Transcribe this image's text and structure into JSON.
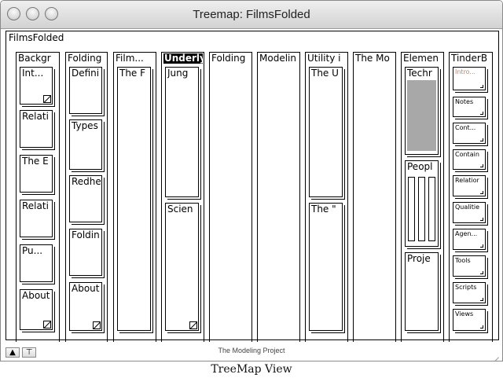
{
  "window": {
    "title": "Treemap: FilmsFolded",
    "close_icon": "close-icon",
    "minimize_icon": "minimize-icon",
    "zoom_icon": "zoom-icon"
  },
  "treemap": {
    "root_label": "FilmsFolded",
    "columns": [
      {
        "label": "Backgr",
        "children": [
          "Int...",
          "Relati",
          "The E",
          "Relati",
          "Pu...",
          "About"
        ]
      },
      {
        "label": "Folding",
        "children": [
          "Defini",
          "Types",
          "Redhe",
          "Foldin",
          "About"
        ]
      },
      {
        "label": "Film...",
        "children": [
          "The F"
        ]
      },
      {
        "label": "Underly",
        "selected": true,
        "children": [
          "Jung",
          "Scien"
        ]
      },
      {
        "label": "Folding",
        "children": []
      },
      {
        "label": "Modelin",
        "children": []
      },
      {
        "label": "Utility i",
        "children": [
          "The U",
          "The \""
        ]
      },
      {
        "label": "The Mo",
        "children": []
      },
      {
        "label": "Elemen",
        "children": [
          "Techr",
          "Peopl",
          "Proje"
        ]
      },
      {
        "label": "TinderB",
        "children": [
          "Intro...",
          "Notes",
          "Cont...",
          "Contain",
          "Relatior",
          "Qualitie",
          "Agen...",
          "Tools",
          "Scripts",
          "Views"
        ]
      }
    ]
  },
  "status": {
    "project_name": "The Modeling Project",
    "up_button_icon": "up-arrow-icon",
    "hoist_button_icon": "hoist-icon"
  },
  "caption": "TreeMap View",
  "colors": {
    "selected_bg": "#000000",
    "fill_gray": "#a8a8a8",
    "faded_text": "#b08a78"
  }
}
